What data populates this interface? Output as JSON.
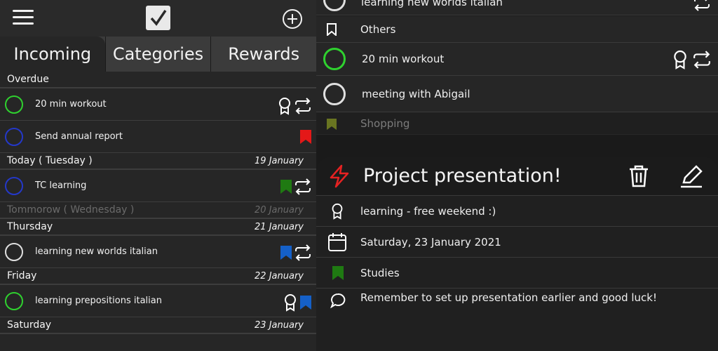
{
  "left": {
    "tabs": [
      "Incoming",
      "Categories",
      "Rewards"
    ],
    "sections": {
      "overdue": "Overdue",
      "today": "Today ( Tuesday )",
      "today_date": "19 January",
      "tomorrow": "Tommorow ( Wednesday )",
      "tomorrow_date": "20 January",
      "thursday": "Thursday",
      "thursday_date": "21 January",
      "friday": "Friday",
      "friday_date": "22 January",
      "saturday": "Saturday",
      "saturday_date": "23 January"
    },
    "tasks": [
      {
        "title": "20 min workout",
        "ring_color": "#2fd12f"
      },
      {
        "title": "Send annual report",
        "ring_color": "#2438c9"
      },
      {
        "title": "TC learning",
        "ring_color": "#2438c9"
      },
      {
        "title": "learning new worlds italian",
        "ring_color": "#e0e0e0"
      },
      {
        "title": "learning prepositions italian",
        "ring_color": "#2fd12f"
      }
    ]
  },
  "right": {
    "top_task": "learning new worlds italian",
    "category_others": "Others",
    "task_workout": "20 min workout",
    "task_meeting": "meeting with Abigail",
    "category_shopping": "Shopping",
    "detail": {
      "title": "Project presentation!",
      "reward": "learning - free weekend :)",
      "date": "Saturday, 23 January 2021",
      "category": "Studies",
      "note": "Remember to set up presentation earlier and good luck!"
    }
  },
  "colors": {
    "green": "#2fd12f",
    "blue": "#2438c9",
    "red_flag": "#e41818",
    "green_flag": "#1f7a12",
    "blue_flag": "#1560c8",
    "lime_flag": "#c9e42a",
    "bolt": "#e52222"
  }
}
